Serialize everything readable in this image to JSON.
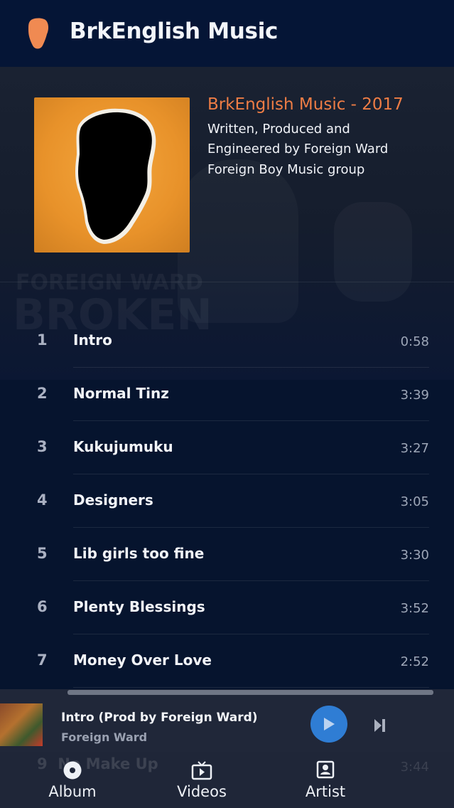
{
  "header": {
    "title": "BrkEnglish Music"
  },
  "album": {
    "title": "BrkEnglish Music - 2017",
    "credits_line1": "Written, Produced and",
    "credits_line2": "Engineered by Foreign Ward",
    "label": "Foreign Boy Music group"
  },
  "background_text": {
    "artist": "FOREIGN WARD",
    "album": "BROKEN"
  },
  "tracks": [
    {
      "num": "1",
      "title": "Intro",
      "duration": "0:58"
    },
    {
      "num": "2",
      "title": "Normal Tinz",
      "duration": "3:39"
    },
    {
      "num": "3",
      "title": "Kukujumuku",
      "duration": "3:27"
    },
    {
      "num": "4",
      "title": "Designers",
      "duration": "3:05"
    },
    {
      "num": "5",
      "title": "Lib girls too fine",
      "duration": "3:30"
    },
    {
      "num": "6",
      "title": "Plenty Blessings",
      "duration": "3:52"
    },
    {
      "num": "7",
      "title": "Money Over Love",
      "duration": "2:52"
    }
  ],
  "partial_track": {
    "num": "9",
    "title": "No Make Up",
    "duration": "3:44"
  },
  "player": {
    "title": "Intro (Prod by Foreign Ward)",
    "artist": "Foreign Ward"
  },
  "nav": [
    {
      "label": "Album",
      "icon": "disc-icon"
    },
    {
      "label": "Videos",
      "icon": "tv-icon"
    },
    {
      "label": "Artist",
      "icon": "contact-icon"
    }
  ],
  "colors": {
    "accent": "#ef7d45",
    "play": "#2f7dd4",
    "background": "#06142e"
  }
}
